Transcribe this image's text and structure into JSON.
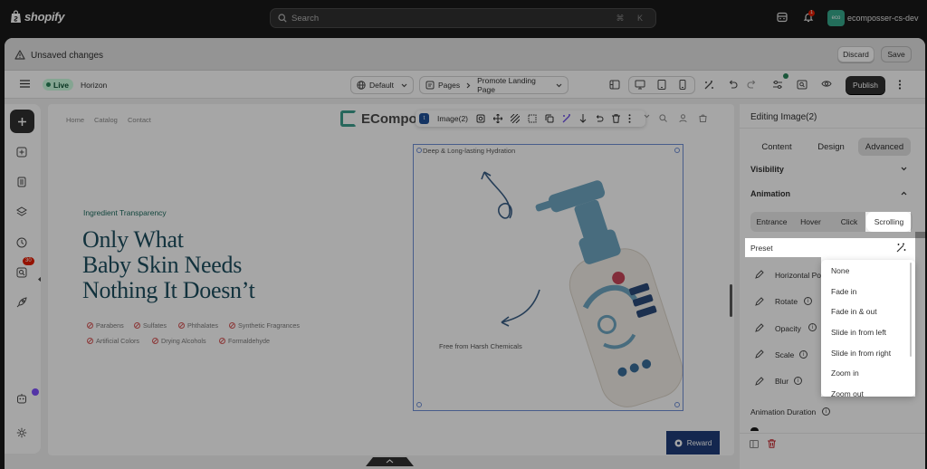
{
  "topbar": {
    "brand": "shopify",
    "search_placeholder": "Search",
    "search_shortcut": "⌘ K",
    "notification_count": "1",
    "store_avatar": "eco",
    "store_name": "ecomposser-cs-dev"
  },
  "unsaved_bar": {
    "title": "Unsaved changes",
    "discard_label": "Discard",
    "save_label": "Save"
  },
  "toolbar": {
    "status": "Live",
    "theme_name": "Horizon",
    "locale": "Default",
    "pages_label": "Pages",
    "page_name": "Promote Landing Page",
    "publish_label": "Publish"
  },
  "left_rail": {
    "badge_count": "30"
  },
  "canvas": {
    "nav_links": [
      "Home",
      "Catalog",
      "Contact"
    ],
    "brand_text": "ECompo",
    "element_toolbar_label": "Image(2)",
    "element_tag": "t",
    "eyebrow": "Ingredient Transparency",
    "headline_lines": [
      "Only What",
      "Baby Skin Needs",
      "Nothing It Doesn’t"
    ],
    "chips_row1": [
      "Parabens",
      "Sulfates",
      "Phthalates",
      "Synthetic Fragrances"
    ],
    "chips_row2": [
      "Artificial Colors",
      "Drying Alcohols",
      "Formaldehyde"
    ],
    "image_label_top": "Deep & Long-lasting Hydration",
    "image_label_bottom": "Free from Harsh Chemicals",
    "reward_label": "Reward"
  },
  "panel": {
    "title": "Editing Image(2)",
    "tabs": [
      "Content",
      "Design",
      "Advanced"
    ],
    "active_tab": "Advanced",
    "visibility_label": "Visibility",
    "animation_label": "Animation",
    "anim_tabs": [
      "Entrance",
      "Hover",
      "Click",
      "Scrolling"
    ],
    "active_anim_tab": "Scrolling",
    "preset_label": "Preset",
    "properties": [
      "Horizontal Po",
      "Rotate",
      "Opacity",
      "Scale",
      "Blur"
    ],
    "animation_duration_label": "Animation Duration",
    "preset_options": [
      "None",
      "Fade in",
      "Fade in & out",
      "Slide in from left",
      "Slide in from right",
      "Zoom in",
      "Zoom out"
    ]
  },
  "colors": {
    "accent_headline": "#1d4e5f",
    "selection": "#6f8fd6",
    "reward_button": "#1f3d7a",
    "live_badge": "#cdfee1"
  }
}
